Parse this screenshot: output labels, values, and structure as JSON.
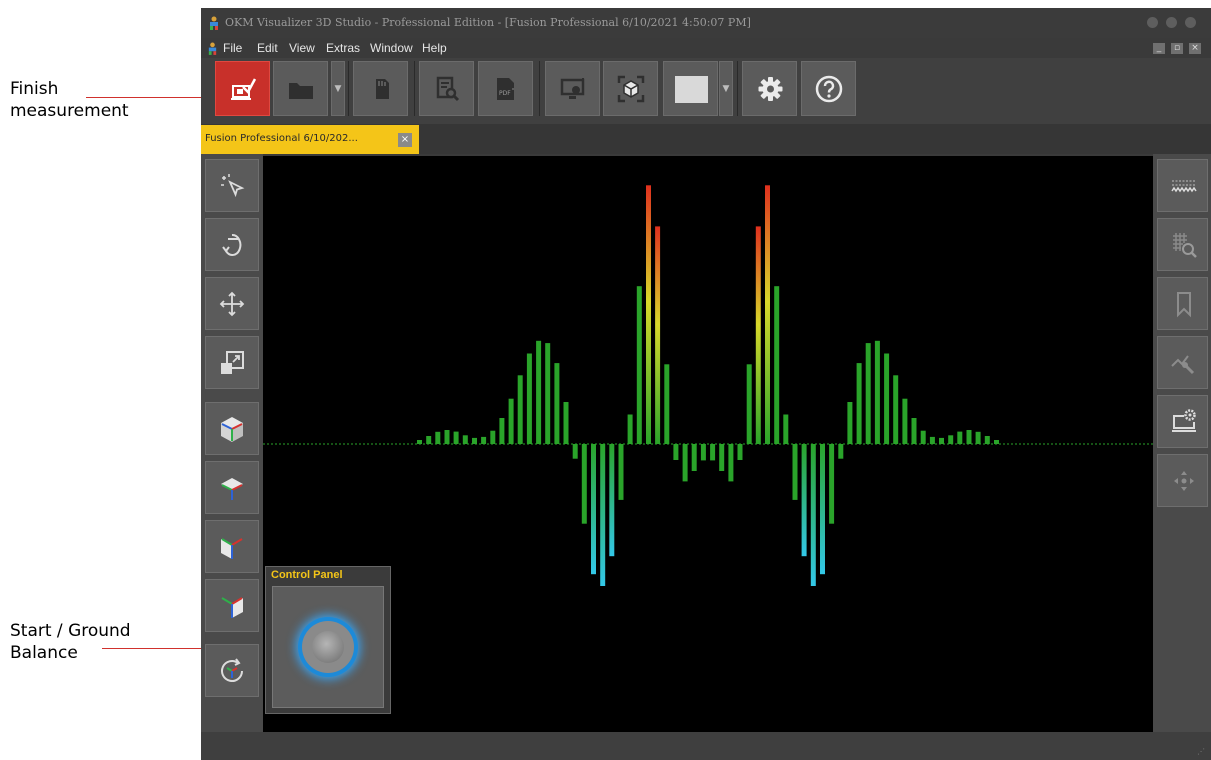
{
  "annotations": {
    "finish_line1": "Finish",
    "finish_line2": "measurement",
    "start_line1": "Start / Ground",
    "start_line2": "Balance"
  },
  "window": {
    "title": "OKM Visualizer 3D Studio - Professional Edition - [Fusion Professional 6/10/2021 4:50:07 PM]"
  },
  "menu": [
    "File",
    "Edit",
    "View",
    "Extras",
    "Window",
    "Help"
  ],
  "toolbar": {
    "buttons": [
      "finish-measurement",
      "open-folder",
      "sd-card",
      "report-search",
      "export-pdf",
      "screenshot",
      "3d-view",
      "color-select",
      "settings",
      "help"
    ],
    "accent": "#c8302a"
  },
  "tab": {
    "label": "Fusion Professional 6/10/202...",
    "color": "#f4c518"
  },
  "control_panel": {
    "title": "Control Panel",
    "button_glow": "#1d8ad8"
  },
  "scan": {
    "count": 96,
    "colors": {
      "green": "#2aa42a",
      "yellow": "#d8d82a",
      "red": "#e0301e",
      "cyan": "#33c8e8"
    }
  }
}
